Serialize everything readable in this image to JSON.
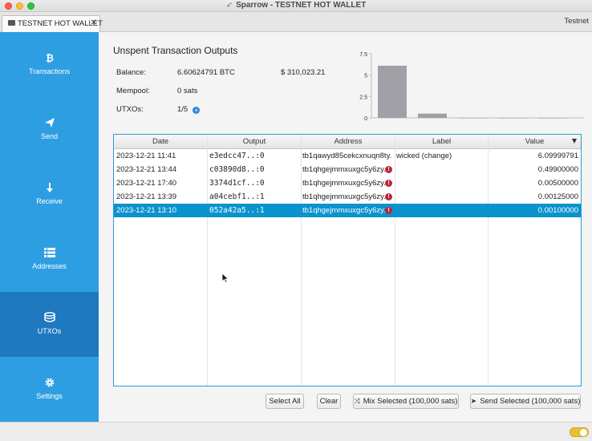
{
  "window": {
    "title": "Sparrow - TESTNET HOT WALLET"
  },
  "tab": {
    "label": "TESTNET HOT WALLET",
    "close": "✕",
    "network": "Testnet"
  },
  "sidebar": {
    "items": [
      {
        "label": "Transactions",
        "icon": "bitcoin-icon"
      },
      {
        "label": "Send",
        "icon": "send-icon"
      },
      {
        "label": "Receive",
        "icon": "receive-icon"
      },
      {
        "label": "Addresses",
        "icon": "addresses-icon"
      },
      {
        "label": "UTXOs",
        "icon": "coins-icon",
        "active": true
      },
      {
        "label": "Settings",
        "icon": "gear-icon"
      }
    ]
  },
  "utxos": {
    "title": "Unspent Transaction Outputs",
    "balance_label": "Balance:",
    "balance_value": "6.60624791 BTC",
    "balance_fiat": "$ 310,023.21",
    "mempool_label": "Mempool:",
    "mempool_value": "0 sats",
    "utxos_label": "UTXOs:",
    "utxos_value": "1/5",
    "add_icon": "+"
  },
  "chart_data": {
    "type": "bar",
    "y_ticks": [
      "7.5",
      "5",
      "2.5",
      "0"
    ],
    "ylim": [
      0,
      7.5
    ],
    "values": [
      6.09999791,
      0.499,
      0.005,
      0.00125,
      0.001
    ]
  },
  "table": {
    "columns": [
      "Date",
      "Output",
      "Address",
      "Label",
      "Value"
    ],
    "rows": [
      {
        "date": "2023-12-21 11:41",
        "output": "e3edcc47..:0",
        "address": "tb1qawyd85cekcxnuqn8ty...",
        "label": "wicked (change)",
        "value": "6.09999791",
        "warn": false
      },
      {
        "date": "2023-12-21 13:44",
        "output": "c03890d8..:0",
        "address": "tb1qhgejmmxuxgc5y6zy...",
        "label": "",
        "value": "0.49900000",
        "warn": true
      },
      {
        "date": "2023-12-21 17:40",
        "output": "3374d1cf..:0",
        "address": "tb1qhgejmmxuxgc5y6zy...",
        "label": "",
        "value": "0.00500000",
        "warn": true
      },
      {
        "date": "2023-12-21 13:39",
        "output": "a04cebf1..:1",
        "address": "tb1qhgejmmxuxgc5y6zy...",
        "label": "",
        "value": "0.00125000",
        "warn": true
      },
      {
        "date": "2023-12-21 13:10",
        "output": "052a42a5..:1",
        "address": "tb1qhgejmmxuxgc5y6zy...",
        "label": "",
        "value": "0.00100000",
        "warn": true,
        "selected": true
      }
    ],
    "warn_glyph": "!"
  },
  "buttons": {
    "select_all": "Select All",
    "clear": "Clear",
    "mix": "Mix Selected (100,000 sats)",
    "send": "Send Selected (100,000 sats)"
  },
  "colors": {
    "sidebar": "#2e9ee2",
    "sidebar_active": "#1e79bf",
    "selection": "#0a93cc",
    "warning": "#c0243b",
    "bar": "#a0a0a6"
  }
}
